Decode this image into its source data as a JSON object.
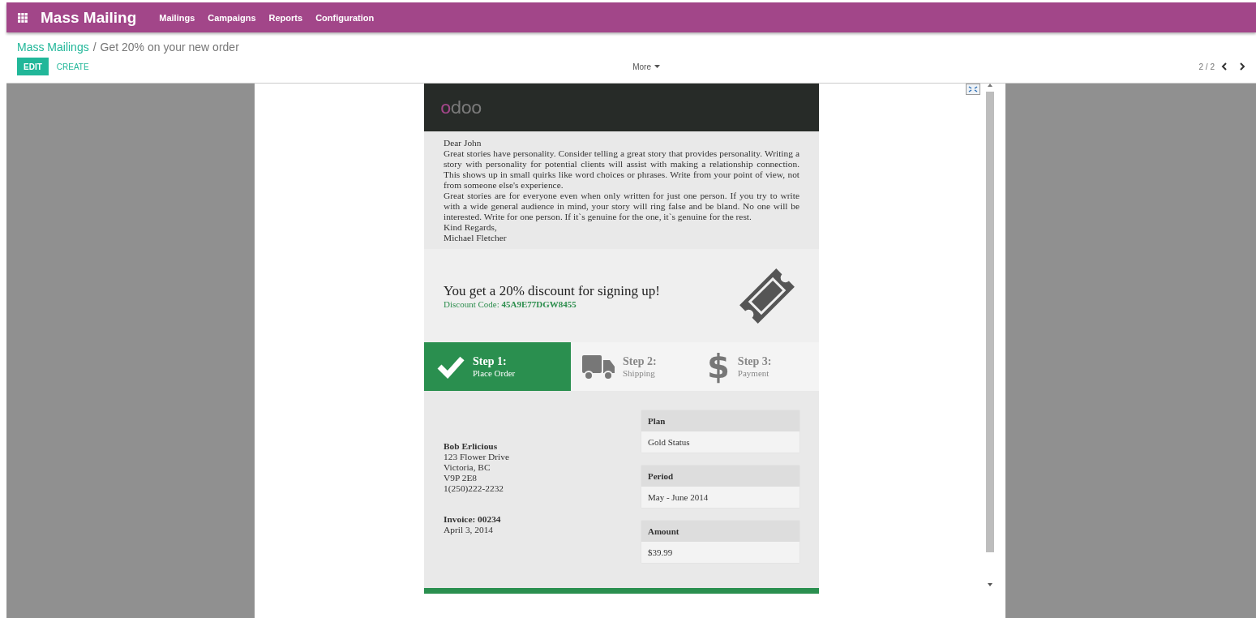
{
  "app_bar": {
    "app_name": "Mass Mailing",
    "menu": [
      "Mailings",
      "Campaigns",
      "Reports",
      "Configuration"
    ]
  },
  "breadcrumb": {
    "parent": "Mass Mailings",
    "separator": "/",
    "current": "Get 20% on your new order"
  },
  "buttons": [
    {
      "label": "EDIT",
      "kind": "primary"
    },
    {
      "label": "CREATE",
      "kind": "link"
    }
  ],
  "more": "More",
  "pager": "2 / 2",
  "email": {
    "logo": "odoo",
    "greeting": "Dear John",
    "paragraphs": [
      "Great stories have personality. Consider telling a great story that provides personality. Writing a story with personality for potential clients will assist with making a relationship connection. This shows up in small quirks like word choices or phrases. Write from your point of view, not from someone else's experience.",
      "Great stories are for everyone even when only written for just one person. If you try to write with a wide general audience in mind, your story will ring false and be bland. No one will be interested. Write for one person. If it`s genuine for the one, it`s genuine for the rest."
    ],
    "closing": "Kind Regards,",
    "signature": "Michael Fletcher",
    "discount": {
      "headline": "You get a 20% discount for signing up!",
      "code_label": "Discount Code:",
      "code": "45A9E77DGW8455"
    },
    "steps": [
      {
        "kind": "check",
        "title": "Step 1:",
        "subtitle": "Place Order",
        "selected": true
      },
      {
        "kind": "truck",
        "title": "Step 2:",
        "subtitle": "Shipping",
        "selected": false
      },
      {
        "kind": "symbol",
        "symbol": "$",
        "title": "Step 3:",
        "subtitle": "Payment",
        "selected": false
      }
    ],
    "customer": {
      "name": "Bob Erlicious",
      "lines": [
        "123 Flower Drive",
        "Victoria, BC",
        "V9P 2E8",
        "1(250)222-2232"
      ]
    },
    "invoice": {
      "number": "Invoice: 00234",
      "date": "April 3, 2014"
    },
    "details": [
      {
        "label": "Plan",
        "value": "Gold Status"
      },
      {
        "label": "Period",
        "value": "May - June 2014"
      },
      {
        "label": "Amount",
        "value": "$39.99"
      }
    ]
  }
}
